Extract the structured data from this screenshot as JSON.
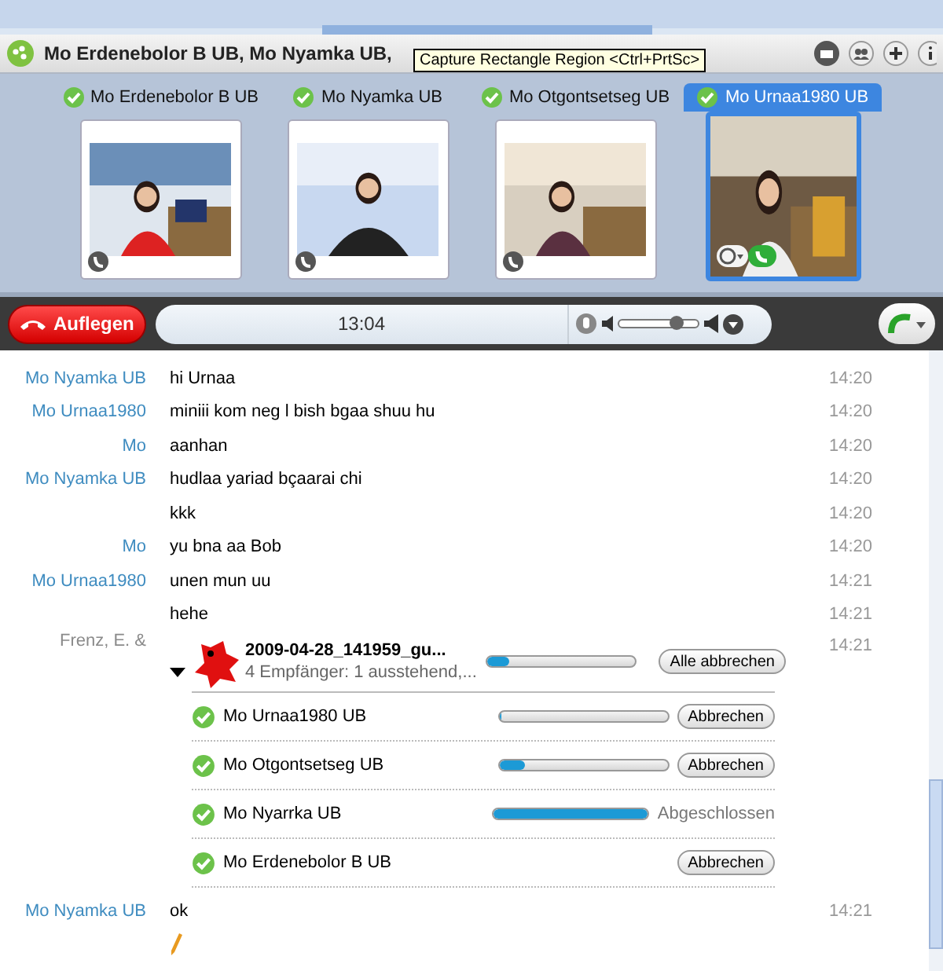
{
  "window": {
    "title": "Mo Erdenebolor B UB, Mo Nyamka UB,"
  },
  "tooltip": {
    "text": "Capture Rectangle Region <Ctrl+PrtSc>"
  },
  "participants": [
    {
      "name": "Mo Erdenebolor B UB",
      "selected": false
    },
    {
      "name": "Mo Nyamka UB",
      "selected": false
    },
    {
      "name": "Mo Otgontsetseg UB",
      "selected": false
    },
    {
      "name": "Mo Urnaa1980 UB",
      "selected": true
    }
  ],
  "call": {
    "hangup": "Auflegen",
    "timer": "13:04",
    "volume": {
      "level": 0.72
    }
  },
  "messages": [
    {
      "sender": "Mo Nyamka UB",
      "text": "hi Urnaa",
      "time": "14:20"
    },
    {
      "sender": "Mo Urnaa1980",
      "text": "miniii kom neg l bish bgaa shuu hu",
      "time": "14:20"
    },
    {
      "sender": "Mo",
      "text": "aanhan",
      "time": "14:20"
    },
    {
      "sender": "Mo Nyamka UB",
      "text": "hudlaa yariad bçaarai chi",
      "time": "14:20"
    },
    {
      "text": "kkk",
      "time": "14:20"
    },
    {
      "sender": "Mo",
      "text": "yu bna aa Bob",
      "time": "14:20"
    },
    {
      "sender": "Mo Urnaa1980",
      "text": "unen mun uu",
      "time": "14:21"
    },
    {
      "text": "hehe",
      "time": "14:21"
    }
  ],
  "transfer": {
    "sender": "Frenz, E. &",
    "time": "14:21",
    "file": "2009-04-28_141959_gu...",
    "summary": "4 Empfänger: 1 ausstehend,...",
    "level": 0.15,
    "cancel_all": "Alle abbrechen",
    "expanded": true,
    "recipients": [
      {
        "name": "Mo Urnaa1980 UB",
        "kind": "pending",
        "level": 0.0,
        "action": "Abbrechen"
      },
      {
        "name": "Mo Otgontsetseg UB",
        "kind": "pending",
        "level": 0.15,
        "action": "Abbrechen"
      },
      {
        "name": "Mo Nyarrka UB",
        "kind": "done",
        "level": 1.0,
        "status": "Abgeschlossen"
      },
      {
        "name": "Mo Erdenebolor B UB",
        "kind": "waiting",
        "action": "Abbrechen"
      }
    ]
  },
  "last_message": {
    "sender": "Mo Nyamka UB",
    "text": "ok",
    "time": "14:21",
    "typing": true
  }
}
